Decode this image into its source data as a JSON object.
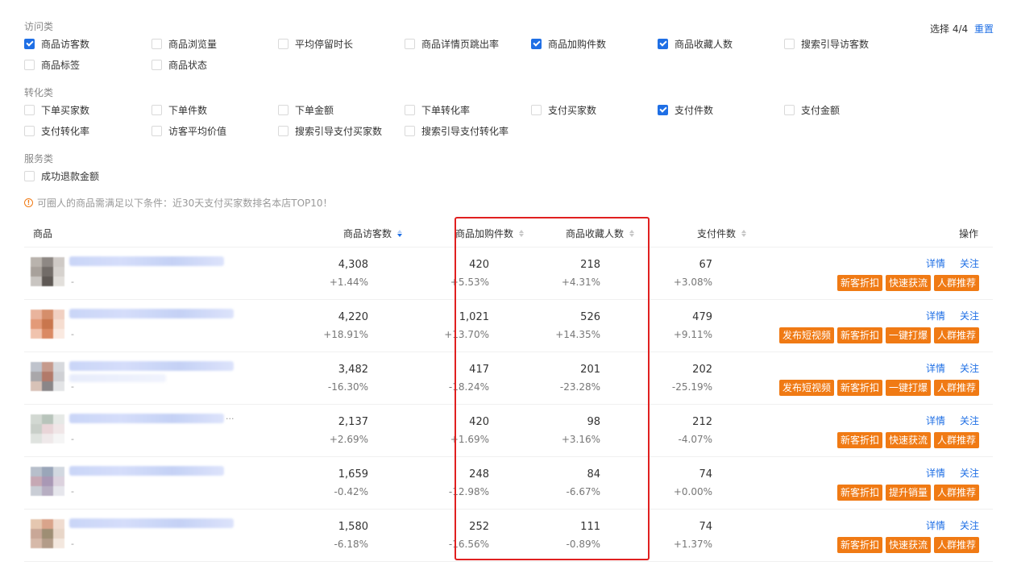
{
  "filters": {
    "groups": [
      {
        "title": "访问类",
        "rows": [
          [
            {
              "label": "商品访客数",
              "checked": true
            },
            {
              "label": "商品浏览量",
              "checked": false
            },
            {
              "label": "平均停留时长",
              "checked": false
            },
            {
              "label": "商品详情页跳出率",
              "checked": false
            },
            {
              "label": "商品加购件数",
              "checked": true
            },
            {
              "label": "商品收藏人数",
              "checked": true
            },
            {
              "label": "搜索引导访客数",
              "checked": false
            }
          ],
          [
            {
              "label": "商品标签",
              "checked": false
            },
            {
              "label": "商品状态",
              "checked": false
            }
          ]
        ]
      },
      {
        "title": "转化类",
        "rows": [
          [
            {
              "label": "下单买家数",
              "checked": false
            },
            {
              "label": "下单件数",
              "checked": false
            },
            {
              "label": "下单金额",
              "checked": false
            },
            {
              "label": "下单转化率",
              "checked": false
            },
            {
              "label": "支付买家数",
              "checked": false
            },
            {
              "label": "支付件数",
              "checked": true
            },
            {
              "label": "支付金额",
              "checked": false
            }
          ],
          [
            {
              "label": "支付转化率",
              "checked": false
            },
            {
              "label": "访客平均价值",
              "checked": false
            },
            {
              "label": "搜索引导支付买家数",
              "checked": false
            },
            {
              "label": "搜索引导支付转化率",
              "checked": false
            }
          ]
        ]
      },
      {
        "title": "服务类",
        "rows": [
          [
            {
              "label": "成功退款金额",
              "checked": false
            }
          ]
        ]
      }
    ],
    "selection_label": "选择 4/4",
    "reset_label": "重置"
  },
  "notice": "可圈人的商品需满足以下条件：近30天支付买家数排名本店TOP10！",
  "table": {
    "headers": {
      "product": "商品",
      "visitors": "商品访客数",
      "cart": "商品加购件数",
      "favorites": "商品收藏人数",
      "paid": "支付件数",
      "actions": "操作"
    },
    "rows": [
      {
        "visitors": "4,308",
        "visitors_chg": "+1.44%",
        "cart": "420",
        "cart_chg": "+5.53%",
        "fav": "218",
        "fav_chg": "+4.31%",
        "paid": "67",
        "paid_chg": "+3.08%",
        "buttons": [
          "新客折扣",
          "快速获流",
          "人群推荐"
        ]
      },
      {
        "visitors": "4,220",
        "visitors_chg": "+18.91%",
        "cart": "1,021",
        "cart_chg": "+13.70%",
        "fav": "526",
        "fav_chg": "+14.35%",
        "paid": "479",
        "paid_chg": "+9.11%",
        "buttons": [
          "发布短视频",
          "新客折扣",
          "一键打爆",
          "人群推荐"
        ]
      },
      {
        "visitors": "3,482",
        "visitors_chg": "-16.30%",
        "cart": "417",
        "cart_chg": "-18.24%",
        "fav": "201",
        "fav_chg": "-23.28%",
        "paid": "202",
        "paid_chg": "-25.19%",
        "buttons": [
          "发布短视频",
          "新客折扣",
          "一键打爆",
          "人群推荐"
        ]
      },
      {
        "visitors": "2,137",
        "visitors_chg": "+2.69%",
        "cart": "420",
        "cart_chg": "+1.69%",
        "fav": "98",
        "fav_chg": "+3.16%",
        "paid": "212",
        "paid_chg": "-4.07%",
        "buttons": [
          "新客折扣",
          "快速获流",
          "人群推荐"
        ]
      },
      {
        "visitors": "1,659",
        "visitors_chg": "-0.42%",
        "cart": "248",
        "cart_chg": "-12.98%",
        "fav": "84",
        "fav_chg": "-6.67%",
        "paid": "74",
        "paid_chg": "+0.00%",
        "buttons": [
          "新客折扣",
          "提升销量",
          "人群推荐"
        ]
      },
      {
        "visitors": "1,580",
        "visitors_chg": "-6.18%",
        "cart": "252",
        "cart_chg": "-16.56%",
        "fav": "111",
        "fav_chg": "-0.89%",
        "paid": "74",
        "paid_chg": "+1.37%",
        "buttons": [
          "新客折扣",
          "快速获流",
          "人群推荐"
        ]
      }
    ],
    "link_detail": "详情",
    "link_follow": "关注",
    "product_placeholder": "-",
    "ellipsis": "..."
  },
  "colors": {
    "accent": "#1f6fe5",
    "action_button": "#f07a14",
    "highlight_border": "#e02020"
  },
  "icons": {
    "notice": "info-circle-icon",
    "sort": "sort-caret-icon"
  }
}
